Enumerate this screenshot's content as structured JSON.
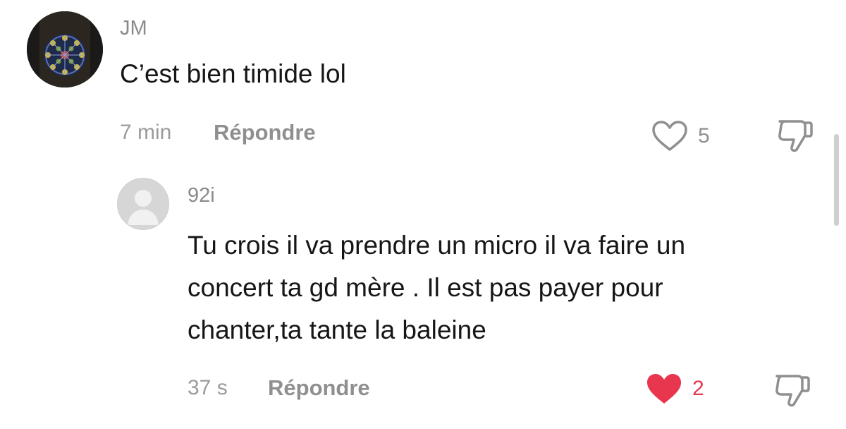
{
  "comments": [
    {
      "user": "JM",
      "text": "C’est bien timide lol",
      "time": "7 min",
      "reply_label": "Répondre",
      "likes": "5",
      "liked": false
    },
    {
      "user": "92i",
      "text_lines": [
        "Tu crois il va prendre un micro il va faire un",
        "concert ta gd mère . Il est pas payer pour",
        "chanter,ta tante la baleine"
      ],
      "time": "37 s",
      "reply_label": "Répondre",
      "likes": "2",
      "liked": true
    }
  ],
  "colors": {
    "liked_heart": "#e8364f",
    "muted_text": "#8f8f8f",
    "body_text": "#161616"
  },
  "icons": {
    "like": "heart-outline-icon",
    "liked": "heart-filled-icon",
    "dislike": "thumbs-down-icon",
    "default_avatar": "default-avatar-icon"
  }
}
